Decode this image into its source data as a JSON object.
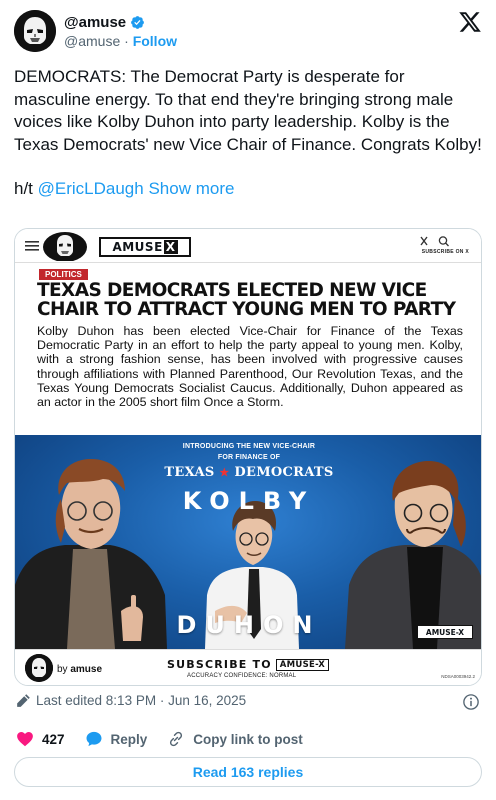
{
  "author": {
    "display_name": "@amuse",
    "handle": "@amuse",
    "separator": "·",
    "follow_label": "Follow"
  },
  "tweet": {
    "text_main": "DEMOCRATS: The Democrat Party is desperate for masculine energy. To that end they're bringing strong male voices like Kolby Duhon into party leadership. Kolby is the Texas Democrats' new Vice Chair of Finance. Congrats Kolby!",
    "ht_prefix": "h/t ",
    "ht_mention": "@EricLDaugh",
    "show_more": "Show more"
  },
  "article": {
    "brand": "AMUSE",
    "brand_x": "X",
    "subscribe_on_x": "SUBSCRIBE ON X",
    "category": "POLITICS",
    "headline": "TEXAS DEMOCRATS ELECTED NEW VICE CHAIR TO ATTRACT YOUNG MEN TO PARTY",
    "body": "Kolby Duhon has been elected Vice-Chair for Finance of the Texas Democratic Party in an effort to help the party appeal to young men. Kolby, with a strong fashion sense, has been involved with progressive causes through affiliations with Planned Parenthood, Our Revolution Texas, and the Texas Young Democrats Socialist Caucus. Additionally, Duhon appeared as an actor in the 2005 short film Once a Storm."
  },
  "poster": {
    "intro_line1": "INTRODUCING THE NEW VICE-CHAIR",
    "intro_line2": "FOR FINANCE OF",
    "texas_left": "TEXAS",
    "texas_right": "DEMOCRATS",
    "first_name": "KOLBY",
    "last_name": "DUHON",
    "brand": "AMUSE-X"
  },
  "footer": {
    "by_prefix": "by",
    "by_name": "amuse",
    "subscribe_label": "SUBSCRIBE TO",
    "subscribe_brand": "AMUSE-X",
    "confidence": "ACCURACY CONFIDENCE: NORMAL",
    "serial": "NDSA0003942.2"
  },
  "meta": {
    "edited": "Last edited 8:13 PM · Jun 16, 2025"
  },
  "actions": {
    "like_count": "427",
    "reply_label": "Reply",
    "copy_label": "Copy link to post",
    "read_replies": "Read 163 replies"
  },
  "colors": {
    "accent": "#1d9bf0",
    "like": "#f91880",
    "muted": "#536471",
    "politics_tag": "#c2272d"
  },
  "icons": [
    "verified-badge-icon",
    "x-logo-icon",
    "pencil-icon",
    "info-icon",
    "heart-icon",
    "reply-bubble-icon",
    "link-icon"
  ]
}
